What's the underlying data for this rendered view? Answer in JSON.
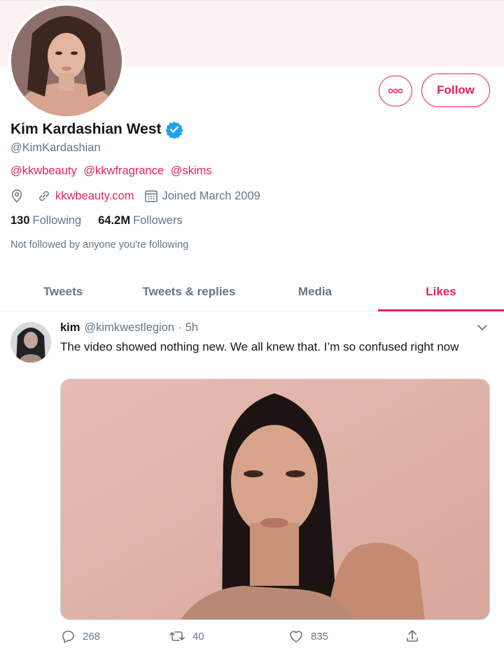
{
  "profile": {
    "display_name": "Kim Kardashian West",
    "handle": "@KimKardashian",
    "bio_mentions": [
      "@kkwbeauty",
      "@kkwfragrance",
      "@skims"
    ],
    "website": "kkwbeauty.com",
    "joined": "Joined March 2009",
    "following_count": "130",
    "following_label": "Following",
    "followers_count": "64.2M",
    "followers_label": "Followers",
    "not_followed_text": "Not followed by anyone you're following",
    "follow_label": "Follow"
  },
  "tabs": [
    {
      "label": "Tweets"
    },
    {
      "label": "Tweets & replies"
    },
    {
      "label": "Media"
    },
    {
      "label": "Likes",
      "active": true
    }
  ],
  "tweet": {
    "name": "kim",
    "handle": "@kimkwestlegion",
    "separator": "·",
    "time": "5h",
    "text": "The video showed nothing new. We all knew that. I’m so confused right now",
    "replies": "268",
    "retweets": "40",
    "likes": "835"
  },
  "colors": {
    "accent": "#e0245e",
    "muted": "#657786",
    "verified": "#1da1f2",
    "banner": "#fdf2f2"
  },
  "icons": [
    "more-icon",
    "verified-badge-icon",
    "location-icon",
    "link-icon",
    "calendar-icon",
    "chevron-down-icon",
    "reply-icon",
    "retweet-icon",
    "heart-icon",
    "share-icon"
  ]
}
